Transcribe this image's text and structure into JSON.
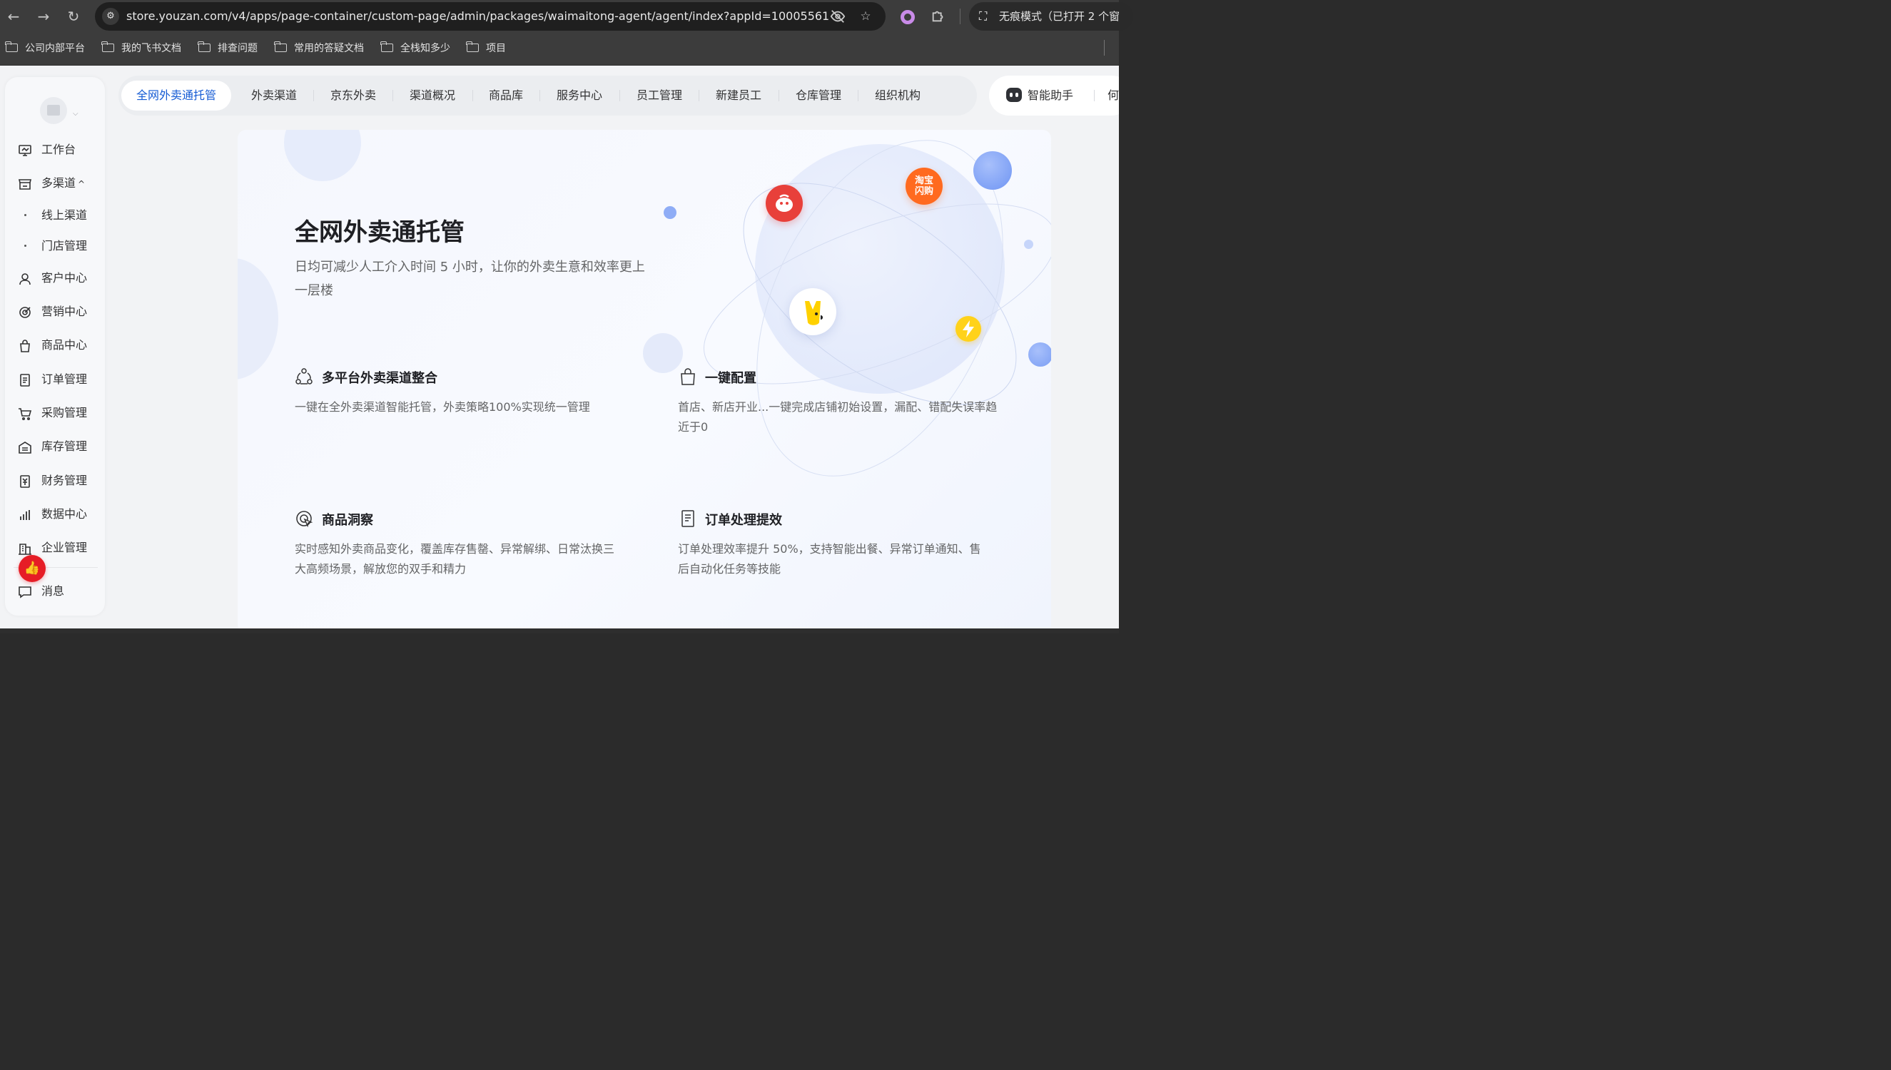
{
  "browser": {
    "url": "store.youzan.com/v4/apps/page-container/custom-page/admin/packages/waimaitong-agent/agent/index?appId=10005561...",
    "incognito_label": "无痕模式（已打开 2 个窗",
    "bookmarks": [
      "公司内部平台",
      "我的飞书文档",
      "排查问题",
      "常用的答疑文档",
      "全栈知多少",
      "项目"
    ]
  },
  "sidebar": {
    "items": [
      {
        "label": "工作台",
        "icon": "workbench-icon"
      },
      {
        "label": "多渠道",
        "icon": "store-icon",
        "expanded": true
      },
      {
        "label": "客户中心",
        "icon": "user-icon"
      },
      {
        "label": "营销中心",
        "icon": "target-icon"
      },
      {
        "label": "商品中心",
        "icon": "bag-icon"
      },
      {
        "label": "订单管理",
        "icon": "order-icon"
      },
      {
        "label": "采购管理",
        "icon": "cart-icon"
      },
      {
        "label": "库存管理",
        "icon": "warehouse-icon"
      },
      {
        "label": "财务管理",
        "icon": "finance-icon"
      },
      {
        "label": "数据中心",
        "icon": "bar-chart-icon"
      },
      {
        "label": "企业管理",
        "icon": "building-icon"
      }
    ],
    "sub_items": [
      "线上渠道",
      "门店管理"
    ],
    "message_label": "消息",
    "multichannel_caret": "^"
  },
  "tabs": [
    {
      "label": "全网外卖通托管",
      "active": true
    },
    {
      "label": "外卖渠道"
    },
    {
      "label": "京东外卖"
    },
    {
      "label": "渠道概况"
    },
    {
      "label": "商品库"
    },
    {
      "label": "服务中心"
    },
    {
      "label": "员工管理"
    },
    {
      "label": "新建员工"
    },
    {
      "label": "仓库管理"
    },
    {
      "label": "组织机构"
    }
  ],
  "assistant": {
    "label": "智能助手",
    "more": "何"
  },
  "hero": {
    "title": "全网外卖通托管",
    "subtitle": "日均可减少人工介入时间 5 小时，让你的外卖生意和效率更上一层楼"
  },
  "features": [
    {
      "title": "多平台外卖渠道整合",
      "desc": "一键在全外卖渠道智能托管，外卖策略100%实现统一管理",
      "icon": "nodes-icon"
    },
    {
      "title": "一键配置",
      "desc": "首店、新店开业...一键完成店铺初始设置，漏配、错配失误率趋近于0",
      "icon": "bag-icon"
    },
    {
      "title": "商品洞察",
      "desc": "实时感知外卖商品变化，覆盖库存售罄、异常解绑、日常汰换三大高频场景，解放您的双手和精力",
      "icon": "insight-icon"
    },
    {
      "title": "订单处理提效",
      "desc": "订单处理效率提升 50%，支持智能出餐、异常订单通知、售后自动化任务等技能",
      "icon": "document-icon"
    }
  ],
  "logos": {
    "taobao": "淘宝\n闪购"
  },
  "colors": {
    "accent": "#155bd4",
    "jd_red": "#e8403a",
    "taobao_orange": "#ff6a1f",
    "meituan_yellow": "#ffd100"
  }
}
